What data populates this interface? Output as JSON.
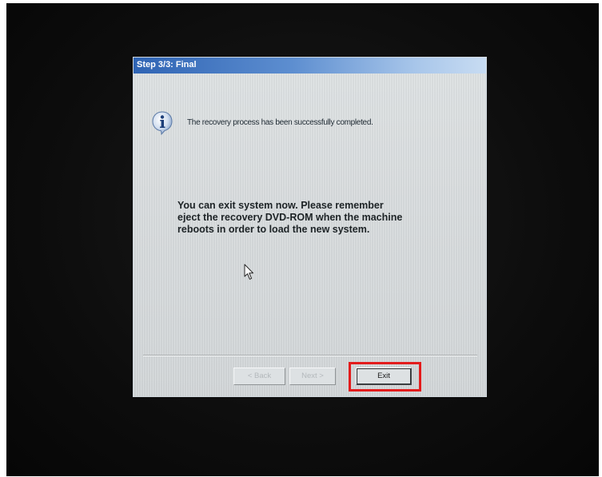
{
  "window": {
    "title": "Step 3/3: Final"
  },
  "status": {
    "icon": "info-icon",
    "message": "The recovery process has been successfully completed."
  },
  "instructions": {
    "line1": "You can exit system now. Please remember",
    "line2": "eject the recovery DVD-ROM when the machine",
    "line3": "reboots in order to load the new system."
  },
  "buttons": {
    "back_label": "< Back",
    "next_label": "Next >",
    "exit_label": "Exit"
  },
  "colors": {
    "title_bar": "#2f64b4",
    "dialog_background": "#dbdfe1",
    "highlight": "#e31c1c",
    "disabled_text": "#b3b8bb"
  },
  "annotations": {
    "highlighted_element": "exit-button"
  }
}
